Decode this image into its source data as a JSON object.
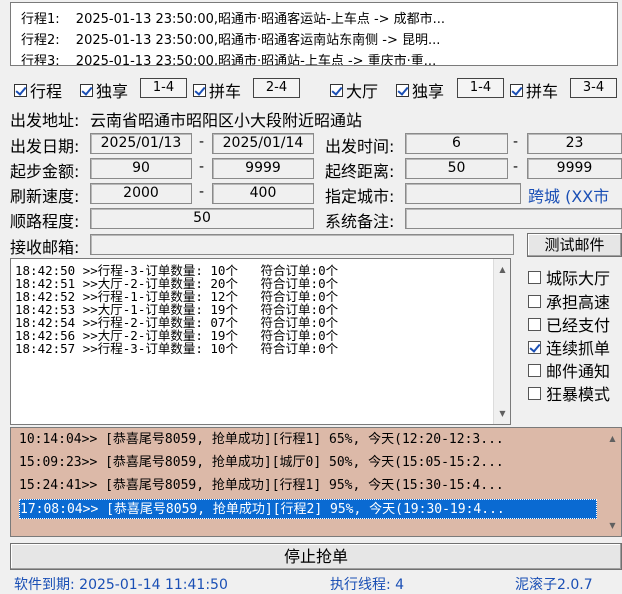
{
  "routes": [
    {
      "label": "行程1:",
      "text": "2025-01-13 23:50:00,昭通市·昭通客运站-上车点 -> 成都市..."
    },
    {
      "label": "行程2:",
      "text": "2025-01-13 23:50:00,昭通市·昭通客运南站东南侧 -> 昆明..."
    },
    {
      "label": "行程3:",
      "text": "2025-01-13 23:50:00,昭通市·昭通站-上车点 -> 重庆市·重..."
    }
  ],
  "filters": {
    "trip": "行程",
    "exclusive": "独享",
    "exclusive_range": "1-4",
    "carpool": "拼车",
    "carpool_range": "2-4",
    "hall": "大厅",
    "hall_exclusive": "独享",
    "hall_exclusive_range": "1-4",
    "hall_carpool": "拼车",
    "hall_carpool_range": "3-4"
  },
  "form": {
    "depart_addr_label": "出发地址:",
    "depart_addr_value": "云南省昭通市昭阳区小大段附近昭通站",
    "depart_date_label": "出发日期:",
    "date_from": "2025/01/13",
    "date_to": "2025/01/14",
    "depart_time_label": "出发时间:",
    "time_from": "6",
    "time_to": "23",
    "start_amount_label": "起步金额:",
    "amount_from": "90",
    "amount_to": "9999",
    "distance_label": "起终距离:",
    "distance_from": "50",
    "distance_to": "9999",
    "refresh_label": "刷新速度:",
    "refresh_from": "2000",
    "refresh_to": "400",
    "city_label": "指定城市:",
    "city_value": "",
    "cross_city": "跨城 (XX市",
    "route_degree_label": "顺路程度:",
    "route_degree_value": "50",
    "remark_label": "系统备注:",
    "remark_value": "",
    "email_label": "接收邮箱:",
    "email_value": "",
    "dash": "-"
  },
  "test_email_button": "测试邮件",
  "log_lines": [
    "18:42:50 >>行程-3-订单数量: 10个   符合订单:0个",
    "18:42:51 >>大厅-2-订单数量: 20个   符合订单:0个",
    "18:42:52 >>行程-1-订单数量: 12个   符合订单:0个",
    "18:42:53 >>大厅-1-订单数量: 19个   符合订单:0个",
    "18:42:54 >>行程-2-订单数量: 07个   符合订单:0个",
    "18:42:56 >>大厅-2-订单数量: 19个   符合订单:0个",
    "18:42:57 >>行程-3-订单数量: 10个   符合订单:0个"
  ],
  "options": [
    {
      "label": "城际大厅",
      "checked": false
    },
    {
      "label": "承担高速",
      "checked": false
    },
    {
      "label": "已经支付",
      "checked": false
    },
    {
      "label": "连续抓单",
      "checked": true
    },
    {
      "label": "邮件通知",
      "checked": false
    },
    {
      "label": "狂暴模式",
      "checked": false
    }
  ],
  "success_lines": [
    "10:14:04>> [恭喜尾号8059, 抢单成功][行程1] 65%, 今天(12:20-12:3...",
    "15:09:23>> [恭喜尾号8059, 抢单成功][城厅0] 50%, 今天(15:05-15:2...",
    "15:24:41>> [恭喜尾号8059, 抢单成功][行程1] 95%, 今天(15:30-15:4...",
    "17:08:04>> [恭喜尾号8059, 抢单成功][行程2] 95%, 今天(19:30-19:4..."
  ],
  "stop_button": "停止抢单",
  "status": {
    "expiry": "软件到期: 2025-01-14 11:41:50",
    "threads": "执行线程: 4",
    "version": "泥滚子2.0.7"
  },
  "colors": {
    "selected": "#0a6ad2",
    "success_bg": "#dcb9a8",
    "accent_text": "#1a4fb5"
  }
}
